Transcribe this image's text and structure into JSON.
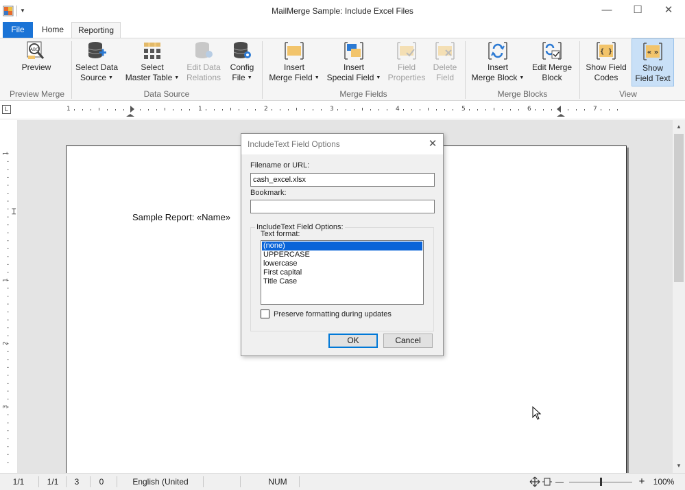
{
  "window": {
    "title": "MailMerge Sample: Include Excel Files",
    "minimize_glyph": "—",
    "maximize_glyph": "☐",
    "close_glyph": "✕"
  },
  "tabs": {
    "file": "File",
    "home": "Home",
    "reporting": "Reporting"
  },
  "ribbon": {
    "groups": {
      "preview_merge": "Preview Merge",
      "data_source": "Data Source",
      "merge_fields": "Merge Fields",
      "merge_blocks": "Merge Blocks",
      "view": "View"
    },
    "buttons": {
      "preview": {
        "l1": "Preview",
        "l2": ""
      },
      "select_data_source": {
        "l1": "Select Data",
        "l2": "Source"
      },
      "select_master_table": {
        "l1": "Select",
        "l2": "Master Table"
      },
      "edit_data_relations": {
        "l1": "Edit Data",
        "l2": "Relations"
      },
      "config_file": {
        "l1": "Config",
        "l2": "File"
      },
      "insert_merge_field": {
        "l1": "Insert",
        "l2": "Merge Field"
      },
      "insert_special_field": {
        "l1": "Insert",
        "l2": "Special Field"
      },
      "field_properties": {
        "l1": "Field",
        "l2": "Properties"
      },
      "delete_field": {
        "l1": "Delete",
        "l2": "Field"
      },
      "insert_merge_block": {
        "l1": "Insert",
        "l2": "Merge Block"
      },
      "edit_merge_block": {
        "l1": "Edit Merge",
        "l2": "Block"
      },
      "show_field_codes": {
        "l1": "Show Field",
        "l2": "Codes"
      },
      "show_field_text": {
        "l1": "Show",
        "l2": "Field Text"
      }
    },
    "colors": {
      "accent": "#1a73d6",
      "active_bg": "#c9e0f7",
      "field_icon": "#f2c46b",
      "disabled": "#a0a0a0"
    }
  },
  "ruler": {
    "corner": "L",
    "numbers": [
      "1",
      "1",
      "2",
      "3",
      "4",
      "5",
      "6",
      "7"
    ],
    "vnumbers": [
      "1",
      "1",
      "2",
      "3"
    ]
  },
  "document": {
    "text": "Sample Report: «Name»"
  },
  "dialog": {
    "title": "IncludeText Field Options",
    "filename_label": "Filename or URL:",
    "filename_value": "cash_excel.xlsx",
    "bookmark_label": "Bookmark:",
    "bookmark_value": "",
    "group_label": "IncludeText Field Options:",
    "text_format_label": "Text format:",
    "formats": [
      "(none)",
      "UPPERCASE",
      "lowercase",
      "First capital",
      "Title Case"
    ],
    "selected_format": "(none)",
    "preserve_label": "Preserve formatting during updates",
    "ok": "OK",
    "cancel": "Cancel"
  },
  "status": {
    "page": "1/1",
    "section": "1/1",
    "line": "3",
    "column": "0",
    "language": "English (United States)",
    "num": "NUM",
    "zoom": "100%",
    "zoom_minus": "—",
    "zoom_plus": "+",
    "zoom_level": 0.5
  }
}
